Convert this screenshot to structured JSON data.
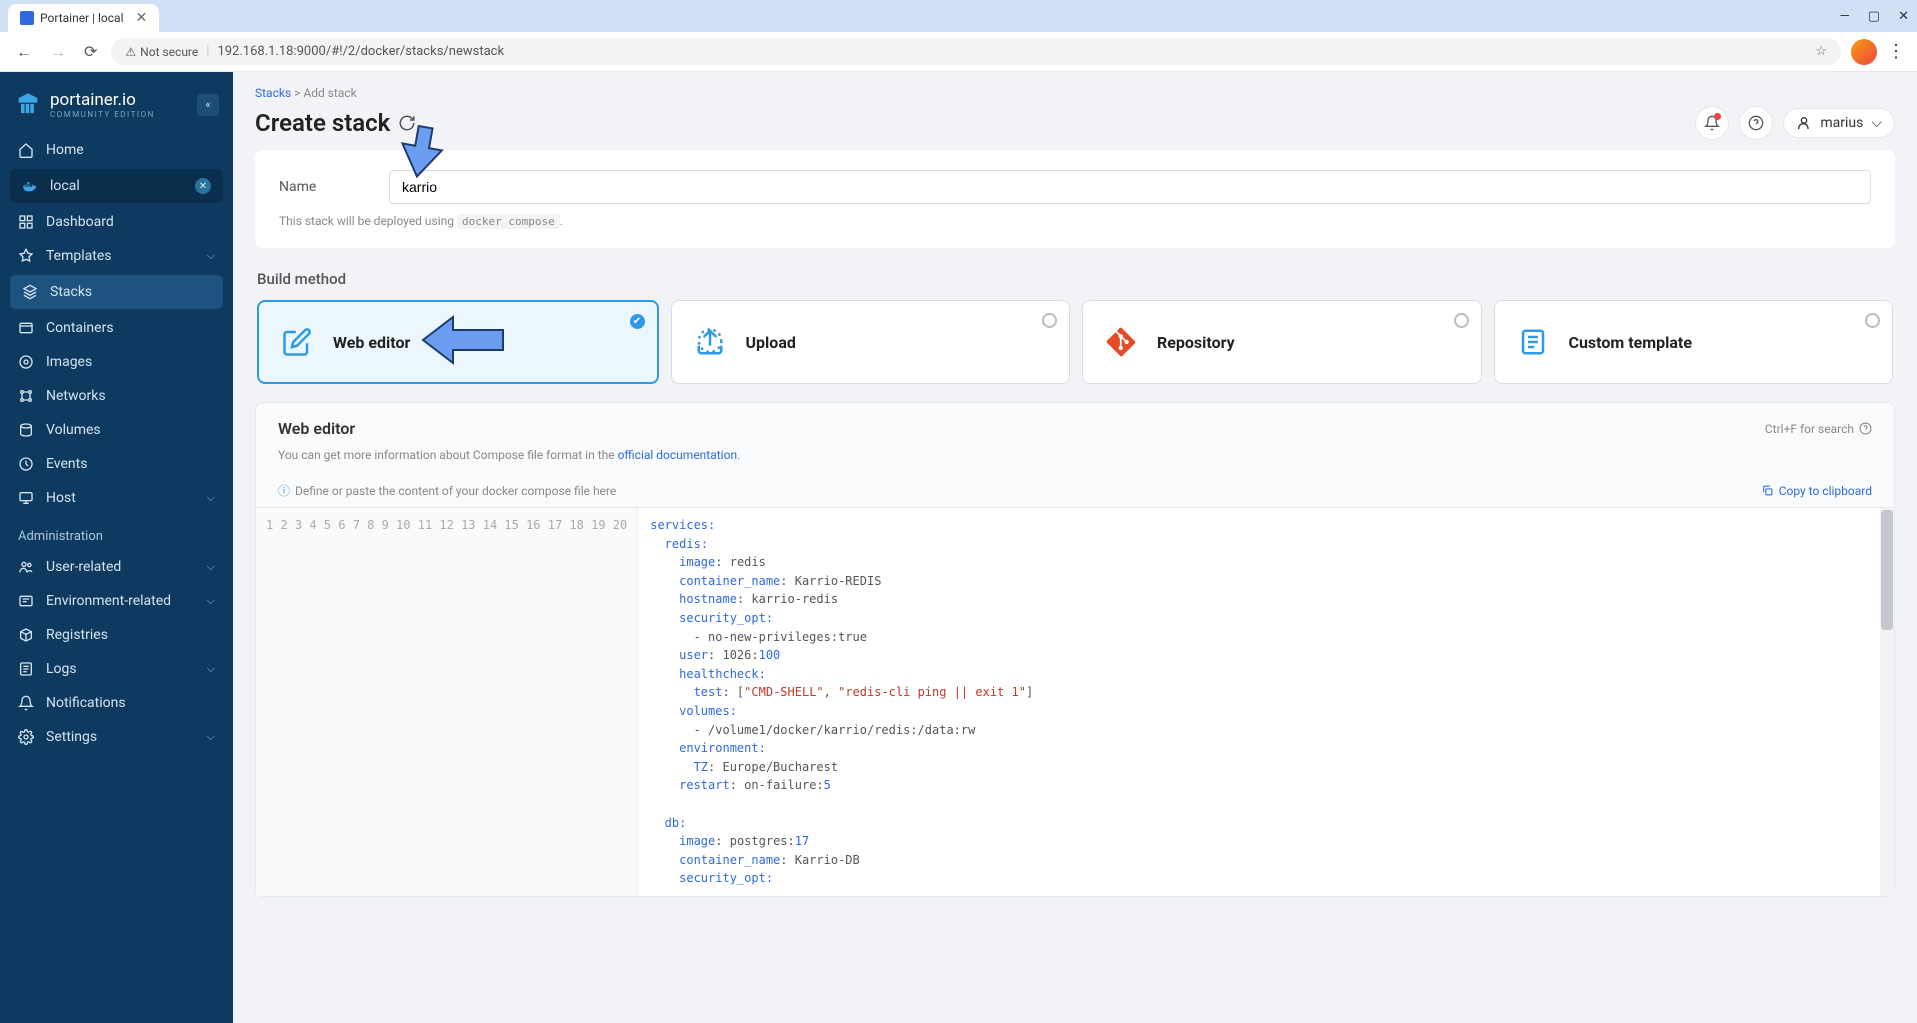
{
  "browser": {
    "tab_title": "Portainer | local",
    "url_badge": "Not secure",
    "url": "192.168.1.18:9000/#!/2/docker/stacks/newstack"
  },
  "sidebar": {
    "logo": "portainer.io",
    "logo_sub": "COMMUNITY EDITION",
    "home": "Home",
    "env": "local",
    "items": [
      {
        "label": "Dashboard",
        "icon": "dashboard"
      },
      {
        "label": "Templates",
        "icon": "templates",
        "chevron": true
      },
      {
        "label": "Stacks",
        "icon": "stacks",
        "active": true
      },
      {
        "label": "Containers",
        "icon": "containers"
      },
      {
        "label": "Images",
        "icon": "images"
      },
      {
        "label": "Networks",
        "icon": "networks"
      },
      {
        "label": "Volumes",
        "icon": "volumes"
      },
      {
        "label": "Events",
        "icon": "events"
      },
      {
        "label": "Host",
        "icon": "host",
        "chevron": true
      }
    ],
    "admin_label": "Administration",
    "admin_items": [
      {
        "label": "User-related",
        "icon": "users",
        "chevron": true
      },
      {
        "label": "Environment-related",
        "icon": "env",
        "chevron": true
      },
      {
        "label": "Registries",
        "icon": "registries"
      },
      {
        "label": "Logs",
        "icon": "logs",
        "chevron": true
      },
      {
        "label": "Notifications",
        "icon": "notifications"
      },
      {
        "label": "Settings",
        "icon": "settings",
        "chevron": true
      }
    ]
  },
  "breadcrumb": {
    "root": "Stacks",
    "sep": ">",
    "current": "Add stack"
  },
  "page_title": "Create stack",
  "user_name": "marius",
  "form": {
    "name_label": "Name",
    "name_value": "karrio",
    "hint_prefix": "This stack will be deployed using ",
    "hint_code": "docker compose",
    "hint_suffix": "."
  },
  "build_method_label": "Build method",
  "methods": [
    {
      "title": "Web editor",
      "selected": true,
      "icon": "edit"
    },
    {
      "title": "Upload",
      "selected": false,
      "icon": "upload"
    },
    {
      "title": "Repository",
      "selected": false,
      "icon": "git"
    },
    {
      "title": "Custom template",
      "selected": false,
      "icon": "template"
    }
  ],
  "editor": {
    "title": "Web editor",
    "search_hint": "Ctrl+F for search",
    "desc_prefix": "You can get more information about Compose file format in the ",
    "desc_link": "official documentation",
    "desc_suffix": ".",
    "placeholder_hint": "Define or paste the content of your docker compose file here",
    "copy_label": "Copy to clipboard"
  },
  "code_lines": [
    [
      {
        "t": "services",
        "c": "ck"
      },
      {
        "t": ":",
        "c": "cc"
      }
    ],
    [
      {
        "t": "  redis",
        "c": "ck"
      },
      {
        "t": ":",
        "c": "cc"
      }
    ],
    [
      {
        "t": "    image",
        "c": "ck"
      },
      {
        "t": ": redis",
        "c": "cn"
      }
    ],
    [
      {
        "t": "    container_name",
        "c": "ck"
      },
      {
        "t": ": Karrio-REDIS",
        "c": "cn"
      }
    ],
    [
      {
        "t": "    hostname",
        "c": "ck"
      },
      {
        "t": ": karrio-redis",
        "c": "cn"
      }
    ],
    [
      {
        "t": "    security_opt",
        "c": "ck"
      },
      {
        "t": ":",
        "c": "cc"
      }
    ],
    [
      {
        "t": "      - no-new-privileges:true",
        "c": "cn"
      }
    ],
    [
      {
        "t": "    user",
        "c": "ck"
      },
      {
        "t": ": 1026:",
        "c": "cn"
      },
      {
        "t": "100",
        "c": "ck"
      }
    ],
    [
      {
        "t": "    healthcheck",
        "c": "ck"
      },
      {
        "t": ":",
        "c": "cc"
      }
    ],
    [
      {
        "t": "      test",
        "c": "ck"
      },
      {
        "t": ": [",
        "c": "cn"
      },
      {
        "t": "\"CMD-SHELL\"",
        "c": "cs"
      },
      {
        "t": ", ",
        "c": "cn"
      },
      {
        "t": "\"redis-cli ping || exit 1\"",
        "c": "cs"
      },
      {
        "t": "]",
        "c": "cn"
      }
    ],
    [
      {
        "t": "    volumes",
        "c": "ck"
      },
      {
        "t": ":",
        "c": "cc"
      }
    ],
    [
      {
        "t": "      - /volume1/docker/karrio/redis:/data:rw",
        "c": "cn"
      }
    ],
    [
      {
        "t": "    environment",
        "c": "ck"
      },
      {
        "t": ":",
        "c": "cc"
      }
    ],
    [
      {
        "t": "      TZ",
        "c": "ck"
      },
      {
        "t": ": Europe/Bucharest",
        "c": "cn"
      }
    ],
    [
      {
        "t": "    restart",
        "c": "ck"
      },
      {
        "t": ": on-failure:",
        "c": "cn"
      },
      {
        "t": "5",
        "c": "ck"
      }
    ],
    [],
    [
      {
        "t": "  db",
        "c": "ck"
      },
      {
        "t": ":",
        "c": "cc"
      }
    ],
    [
      {
        "t": "    image",
        "c": "ck"
      },
      {
        "t": ": postgres:",
        "c": "cn"
      },
      {
        "t": "17",
        "c": "ck"
      }
    ],
    [
      {
        "t": "    container_name",
        "c": "ck"
      },
      {
        "t": ": Karrio-DB",
        "c": "cn"
      }
    ],
    [
      {
        "t": "    security_opt",
        "c": "ck"
      },
      {
        "t": ":",
        "c": "cc"
      }
    ]
  ]
}
